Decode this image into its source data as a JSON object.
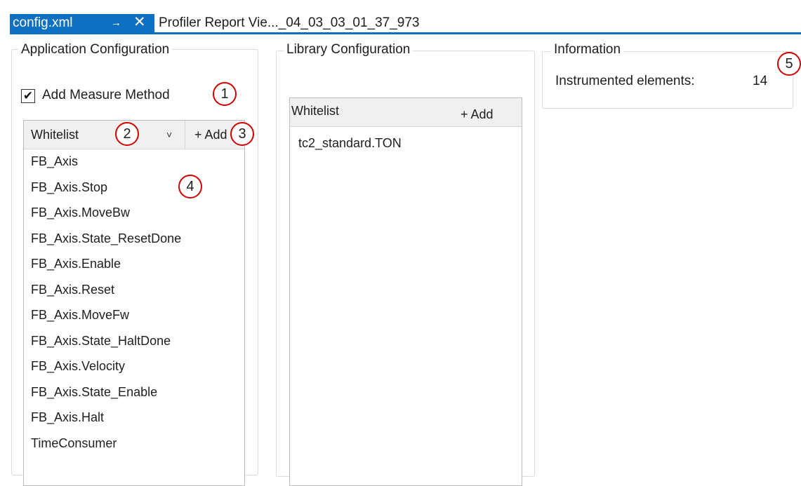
{
  "tabs": {
    "active": {
      "label": "config.xml",
      "pin_glyph": "→",
      "close_glyph": "✕"
    },
    "inactive": {
      "label": "Profiler Report Vie..._04_03_03_01_37_973"
    }
  },
  "app_config": {
    "title": "Application Configuration",
    "checkbox": {
      "label": "Add Measure Method",
      "checked": true,
      "mark": "✔"
    },
    "list": {
      "header_label": "Whitelist",
      "chevron": "˅",
      "add_label": "+ Add",
      "items": [
        "FB_Axis",
        "FB_Axis.Stop",
        "FB_Axis.MoveBw",
        "FB_Axis.State_ResetDone",
        "FB_Axis.Enable",
        "FB_Axis.Reset",
        "FB_Axis.MoveFw",
        "FB_Axis.State_HaltDone",
        "FB_Axis.Velocity",
        "FB_Axis.State_Enable",
        "FB_Axis.Halt",
        "TimeConsumer"
      ]
    }
  },
  "lib_config": {
    "title": "Library Configuration",
    "list": {
      "header_label": "Whitelist",
      "add_label": "+ Add",
      "items": [
        "tc2_standard.TON"
      ]
    }
  },
  "information": {
    "title": "Information",
    "label": "Instrumented elements:",
    "value": "14"
  },
  "callouts": [
    "1",
    "2",
    "3",
    "4",
    "5"
  ],
  "colors": {
    "accent": "#0e70c0",
    "callout": "#d00000"
  }
}
